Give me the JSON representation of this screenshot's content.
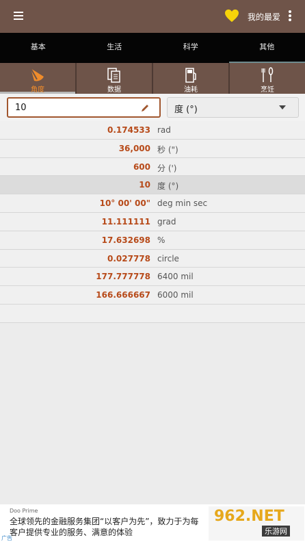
{
  "header": {
    "favorites_label": "我的最爱",
    "accent_color": "#6f5449",
    "heart_color": "#f6d40a"
  },
  "tabs": [
    {
      "label": "基本",
      "active": false
    },
    {
      "label": "生活",
      "active": false
    },
    {
      "label": "科学",
      "active": false
    },
    {
      "label": "其他",
      "active": true
    }
  ],
  "subtabs": [
    {
      "label": "角度",
      "icon": "angle-icon",
      "active": true
    },
    {
      "label": "数据",
      "icon": "data-icon",
      "active": false
    },
    {
      "label": "油耗",
      "icon": "fuel-icon",
      "active": false
    },
    {
      "label": "烹饪",
      "icon": "cooking-icon",
      "active": false
    }
  ],
  "input": {
    "value": "10",
    "unit": "度 (°)"
  },
  "results": [
    {
      "value": "0.174533",
      "unit": "rad",
      "highlight": false
    },
    {
      "value": "36,000",
      "unit": "秒 (\")",
      "highlight": false
    },
    {
      "value": "600",
      "unit": "分 (')",
      "highlight": false
    },
    {
      "value": "10",
      "unit": "度 (°)",
      "highlight": true
    },
    {
      "value": "10° 00' 00\"",
      "unit": "deg min sec",
      "highlight": false
    },
    {
      "value": "11.111111",
      "unit": "grad",
      "highlight": false
    },
    {
      "value": "17.632698",
      "unit": "%",
      "highlight": false
    },
    {
      "value": "0.027778",
      "unit": "circle",
      "highlight": false
    },
    {
      "value": "177.777778",
      "unit": "6400 mil",
      "highlight": false
    },
    {
      "value": "166.666667",
      "unit": "6000 mil",
      "highlight": false
    }
  ],
  "ad": {
    "brand": "Doo Prime",
    "line1": "全球领先的金融服务集团“以客户为先”，致力于为每",
    "line2": "客户提供专业的服务、满意的体验",
    "tag": "广告",
    "logo_big": "962.NET",
    "logo_small": "乐游网"
  }
}
